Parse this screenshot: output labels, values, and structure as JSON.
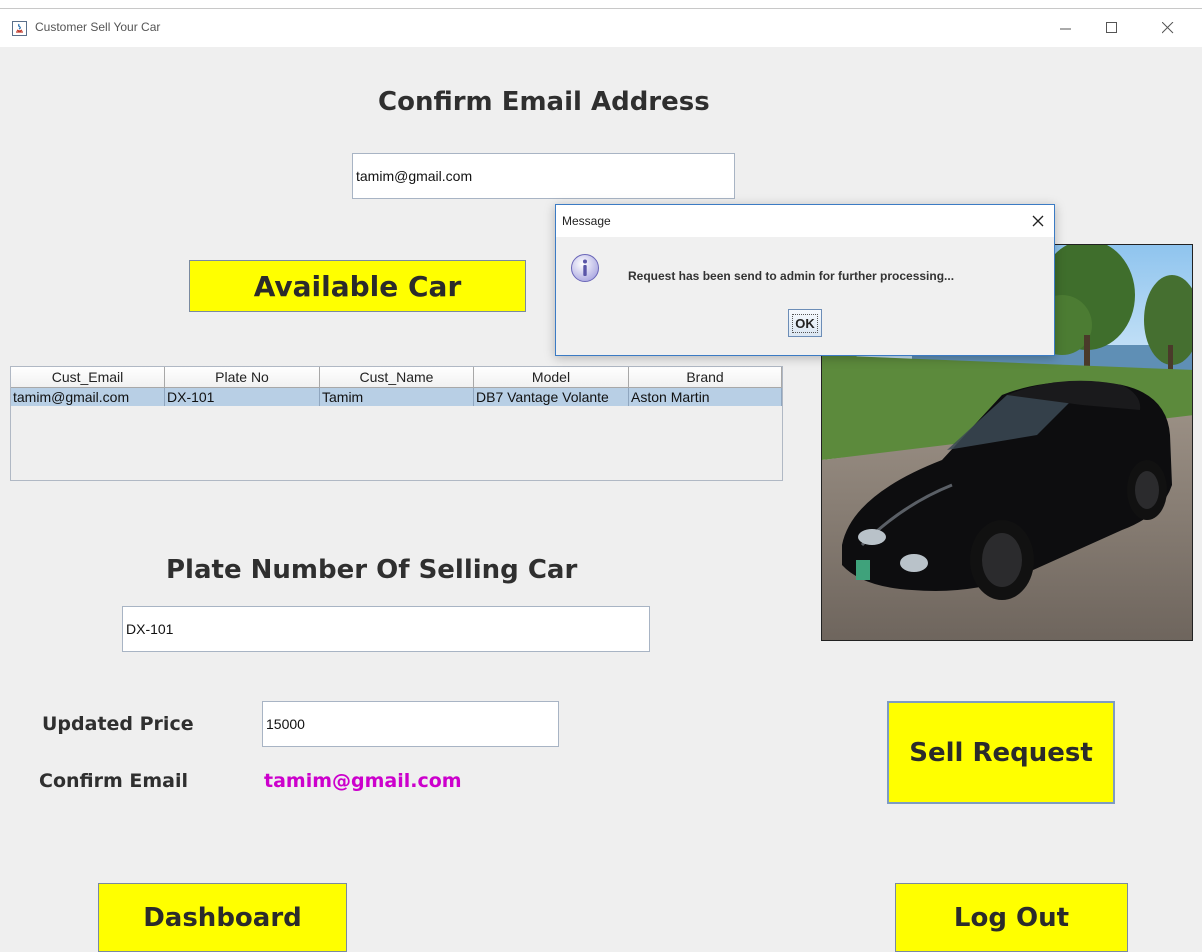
{
  "window": {
    "title": "Customer Sell Your Car"
  },
  "form": {
    "confirm_email_heading": "Confirm Email Address",
    "email_value": "tamim@gmail.com",
    "available_car_button": "Available Car",
    "plate_heading": "Plate Number Of Selling Car",
    "plate_value": "DX-101",
    "updated_price_label": "Updated Price",
    "updated_price_value": "15000",
    "confirm_email_label": "Confirm Email",
    "confirm_email_value": "tamim@gmail.com",
    "confirm_email_color": "#cc00cc"
  },
  "table": {
    "columns": [
      "Cust_Email",
      "Plate No",
      "Cust_Name",
      "Model",
      "Brand"
    ],
    "rows": [
      [
        "tamim@gmail.com",
        "DX-101",
        "Tamim",
        "DB7 Vantage Volante",
        "Aston Martin"
      ]
    ]
  },
  "buttons": {
    "sell_request": "Sell Request",
    "dashboard": "Dashboard",
    "log_out": "Log Out",
    "accent_color": "#ffff00"
  },
  "dialog": {
    "title": "Message",
    "message": "Request has been send to admin for further processing...",
    "ok_label": "OK",
    "icon": "info-icon"
  }
}
